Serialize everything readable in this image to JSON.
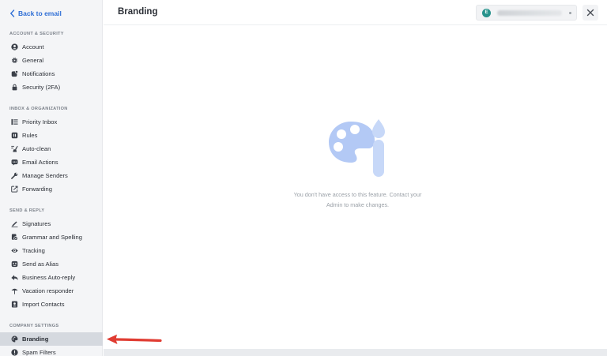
{
  "sidebar": {
    "back_label": "Back to email",
    "sections": {
      "account_security": "ACCOUNT & SECURITY",
      "inbox_organization": "INBOX & ORGANIZATION",
      "send_reply": "SEND & REPLY",
      "company_settings": "COMPANY SETTINGS"
    },
    "items": {
      "account": "Account",
      "general": "General",
      "notifications": "Notifications",
      "security": "Security (2FA)",
      "priority_inbox": "Priority Inbox",
      "rules": "Rules",
      "auto_clean": "Auto-clean",
      "email_actions": "Email Actions",
      "manage_senders": "Manage Senders",
      "forwarding": "Forwarding",
      "signatures": "Signatures",
      "grammar": "Grammar and Spelling",
      "tracking": "Tracking",
      "send_as_alias": "Send as Alias",
      "business_auto_reply": "Business Auto-reply",
      "vacation_responder": "Vacation responder",
      "import_contacts": "Import Contacts",
      "branding": "Branding",
      "spam_filters": "Spam Filters"
    },
    "active_item": "Branding"
  },
  "header": {
    "title": "Branding",
    "avatar_initial": "E"
  },
  "main": {
    "empty_message_line1": "You don't have access to this feature. Contact your",
    "empty_message_line2": "Admin to make changes."
  },
  "colors": {
    "accent_link": "#2f6fd6",
    "avatar": "#27938c",
    "active_item_bg": "#d5d9df",
    "annotation_arrow": "#e03c32",
    "illustration": "#a9c4f5"
  }
}
